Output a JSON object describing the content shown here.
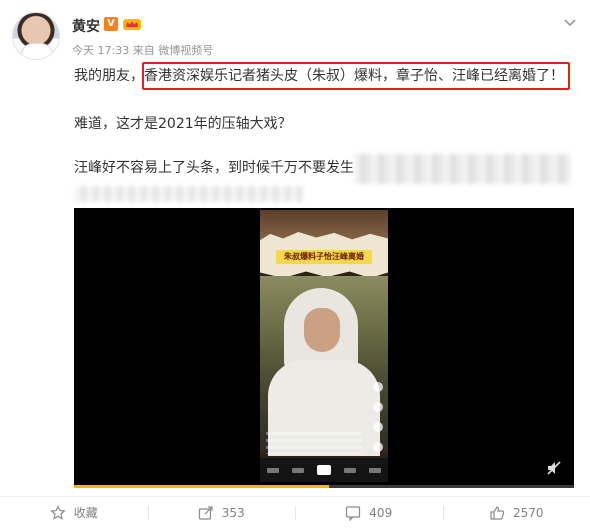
{
  "post": {
    "author": "黄安",
    "verified_badge": "V",
    "meta": "今天 17:33 来自 微博视频号",
    "line1_prefix": "我的朋友，",
    "line1_highlight": "香港资深娱乐记者猪头皮（朱叔）爆料，章子怡、汪峰已经离婚了！",
    "line2": "难道，这才是2021年的压轴大戏？",
    "line3": "汪峰好不容易上了头条，到时候千万不要发生",
    "highlight_color": "#e0201a"
  },
  "video": {
    "banner_text": "朱叔爆料子怡汪峰离婚",
    "progress_percent": 51
  },
  "actions": {
    "favorite_label": "收藏",
    "share_count": "353",
    "comment_count": "409",
    "like_count": "2570"
  },
  "icons": [
    "chevron-down-icon",
    "crown-icon",
    "mute-icon",
    "star-icon",
    "share-icon",
    "comment-icon",
    "like-icon"
  ]
}
